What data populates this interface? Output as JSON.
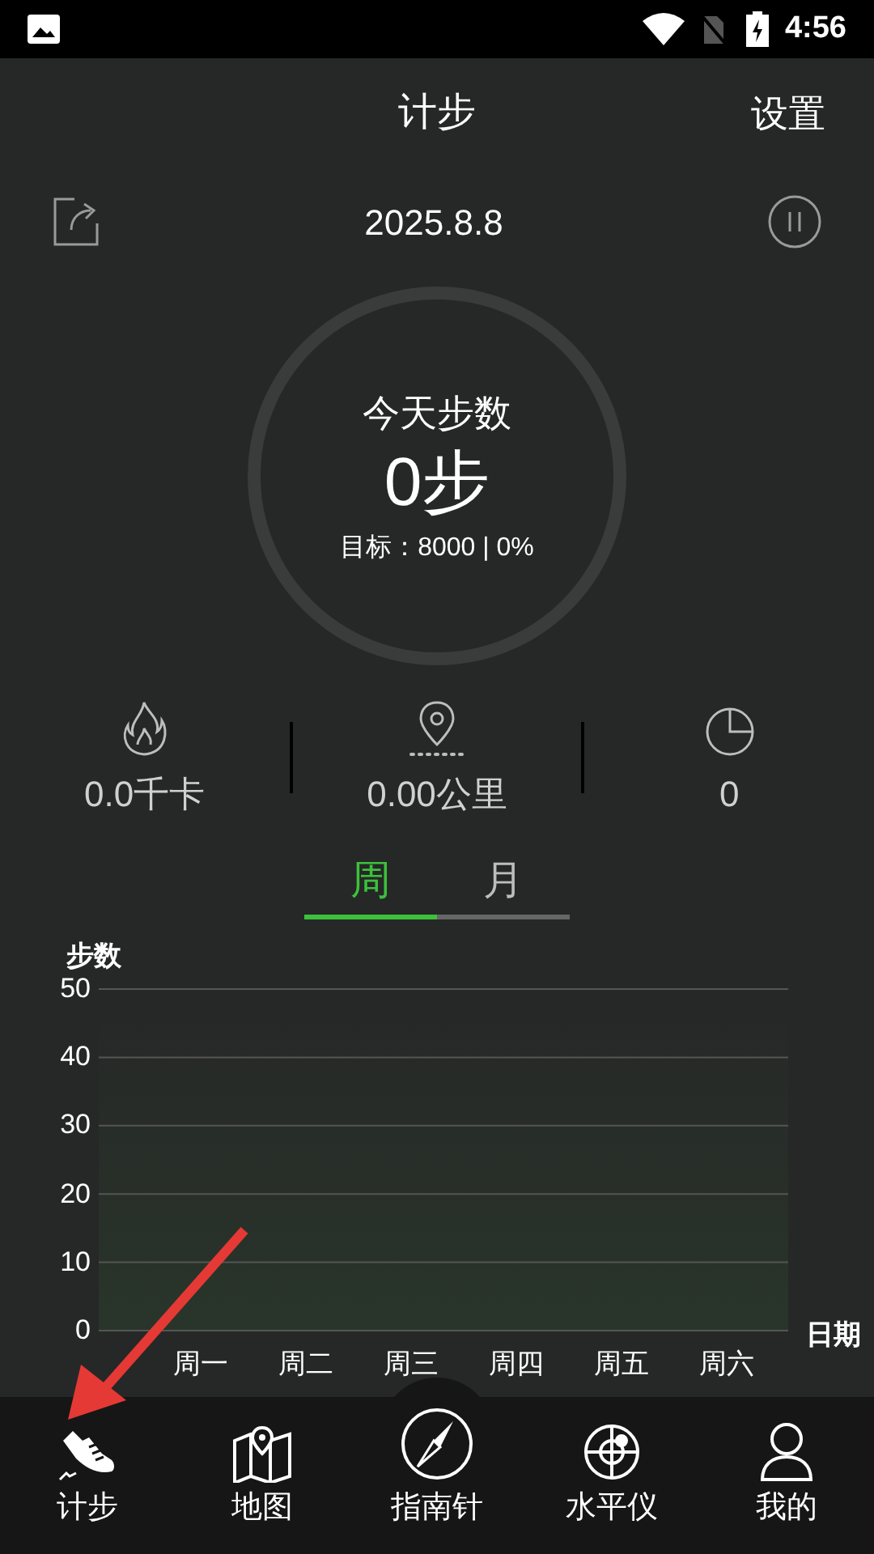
{
  "status_bar": {
    "time": "4:56"
  },
  "header": {
    "title": "计步",
    "action": "设置"
  },
  "date_row": {
    "date": "2025.8.8"
  },
  "ring": {
    "label": "今天步数",
    "steps": "0步",
    "goal": "目标：8000 | 0%",
    "level": 0
  },
  "stats": [
    {
      "kind": "calories",
      "value": "0.0千卡"
    },
    {
      "kind": "distance",
      "value": "0.00公里"
    },
    {
      "kind": "time",
      "value": "0"
    }
  ],
  "period_tabs": [
    {
      "label": "周",
      "selected": true
    },
    {
      "label": "月",
      "selected": false
    }
  ],
  "chart": {
    "chart_data": {
      "type": "area",
      "ylabel": "步数",
      "xlabel": "日期",
      "categories": [
        "周一",
        "周二",
        "周三",
        "周四",
        "周五",
        "周六"
      ],
      "ylim": [
        0,
        50
      ],
      "yticks": [
        0,
        10,
        20,
        30,
        40,
        50
      ],
      "grid": true
    }
  },
  "bottom_nav": [
    {
      "kind": "shoe",
      "label": "计步"
    },
    {
      "kind": "map",
      "label": "地图"
    },
    {
      "kind": "compass",
      "label": "指南针"
    },
    {
      "kind": "level",
      "label": "水平仪"
    },
    {
      "kind": "person",
      "label": "我的"
    }
  ]
}
